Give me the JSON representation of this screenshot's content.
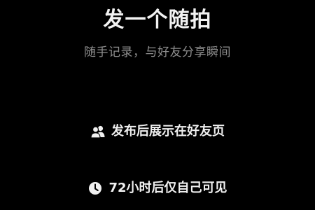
{
  "header": {
    "title": "发一个随拍",
    "subtitle": "随手记录，与好友分享瞬间"
  },
  "features": [
    {
      "icon": "friends-icon",
      "label": "发布后展示在好友页"
    },
    {
      "icon": "clock-icon",
      "label": "72小时后仅自己可见"
    }
  ],
  "colors": {
    "background": "#000000",
    "title": "#f2f2f2",
    "subtitle": "#8e8e8e",
    "feature_text": "#f0f0f0"
  }
}
